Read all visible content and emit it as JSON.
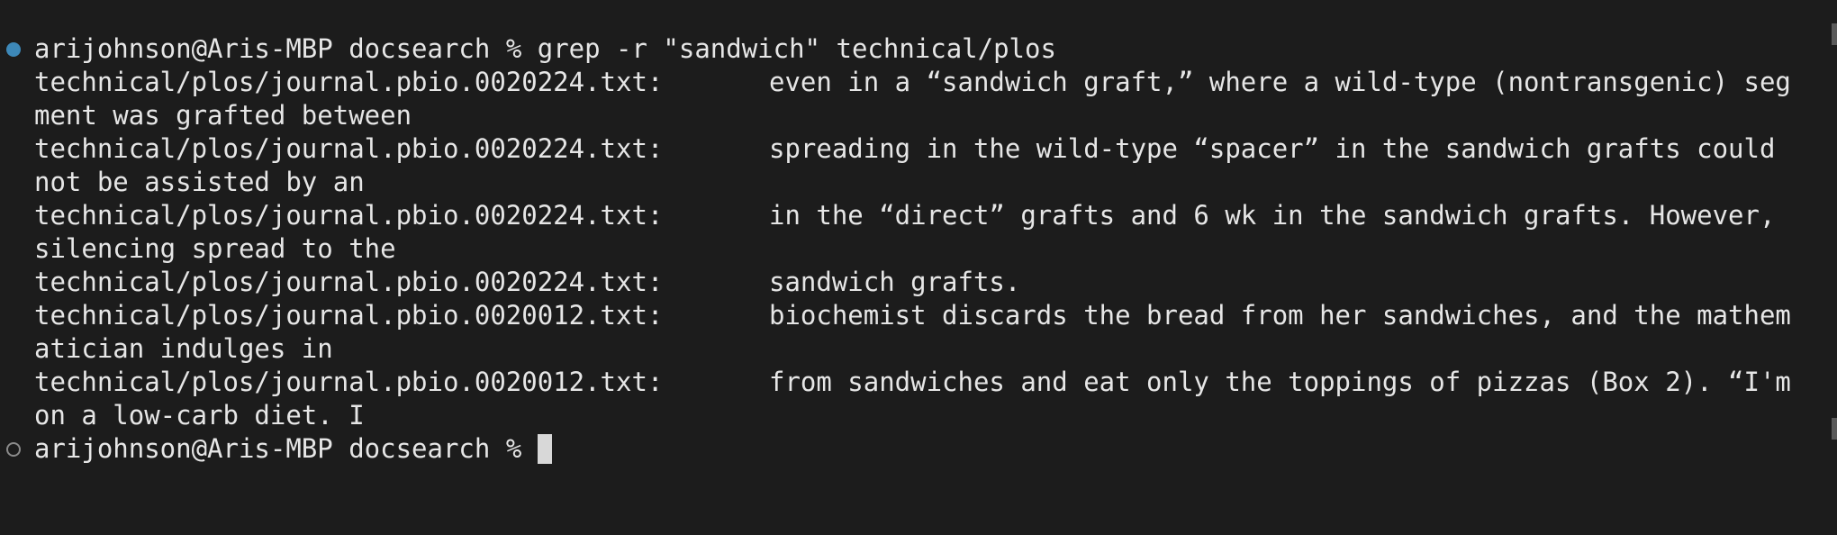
{
  "prompt": {
    "user_host": "arijohnson@Aris-MBP",
    "cwd": "docsearch",
    "symbol": "%"
  },
  "command": "grep -r \"sandwich\" technical/plos",
  "results": [
    {
      "path": "technical/plos/journal.pbio.0020224.txt:",
      "match": "even in a “sandwich graft,” where a wild-type (nontransgenic) segment was grafted between"
    },
    {
      "path": "technical/plos/journal.pbio.0020224.txt:",
      "match": "spreading in the wild-type “spacer” in the sandwich grafts could not be assisted by an"
    },
    {
      "path": "technical/plos/journal.pbio.0020224.txt:",
      "match": "in the “direct” grafts and 6 wk in the sandwich grafts. However, silencing spread to the"
    },
    {
      "path": "technical/plos/journal.pbio.0020224.txt:",
      "match": "sandwich grafts."
    },
    {
      "path": "technical/plos/journal.pbio.0020012.txt:",
      "match": "biochemist discards the bread from her sandwiches, and the mathematician indulges in"
    },
    {
      "path": "technical/plos/journal.pbio.0020012.txt:",
      "match": "from sandwiches and eat only the toppings of pizzas (Box 2). “I'm on a low-carb diet. I"
    }
  ],
  "colors": {
    "background": "#1c1c1c",
    "foreground": "#e6e6e6",
    "marker_done": "#3d88b8",
    "marker_pending": "#8a8a8a"
  }
}
